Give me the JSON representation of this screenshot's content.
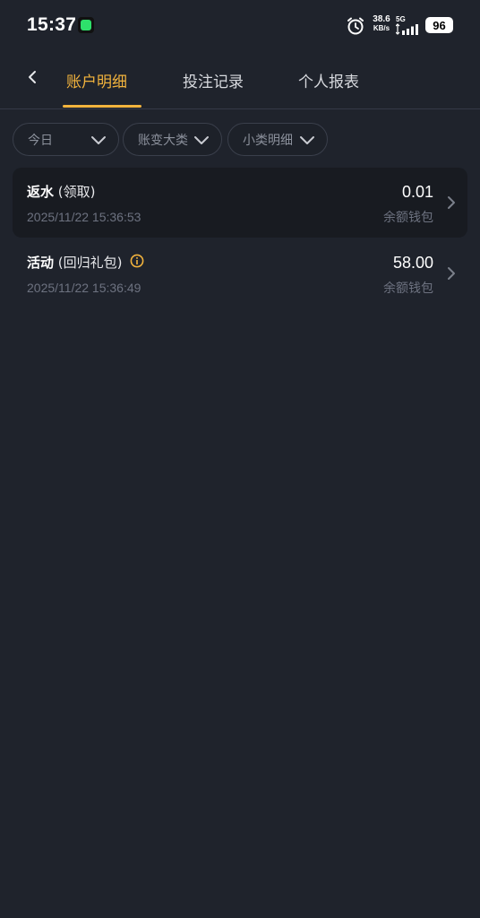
{
  "status_bar": {
    "time": "15:37",
    "net_speed_value": "38.6",
    "net_speed_unit": "KB/s",
    "network_type": "5G",
    "battery": "96"
  },
  "tabs": [
    {
      "label": "账户明细",
      "active": true
    },
    {
      "label": "投注记录",
      "active": false
    },
    {
      "label": "个人报表",
      "active": false
    }
  ],
  "filters": [
    {
      "label": "今日"
    },
    {
      "label": "账变大类"
    },
    {
      "label": "小类明细"
    }
  ],
  "records": [
    {
      "title": "返水",
      "subtitle": "(领取)",
      "time": "2025/11/22 15:36:53",
      "amount": "0.01",
      "wallet": "余额钱包",
      "has_info": false
    },
    {
      "title": "活动",
      "subtitle": "(回归礼包)",
      "time": "2025/11/22 15:36:49",
      "amount": "58.00",
      "wallet": "余额钱包",
      "has_info": true
    }
  ],
  "colors": {
    "background": "#1f232c",
    "accent": "#f2b33d",
    "muted_text": "#6d7280"
  }
}
